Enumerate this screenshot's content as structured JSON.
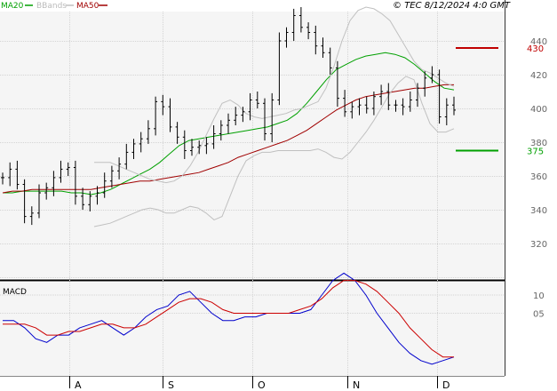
{
  "header": {
    "legend": [
      {
        "label": "MA20",
        "color": "#00a000"
      },
      {
        "label": "BBands",
        "color": "#c0c0c0"
      },
      {
        "label": "MA50",
        "color": "#a00000"
      }
    ],
    "timestamp": "© TEC 8/12/2024 4:0 GMT"
  },
  "macd_panel": {
    "label": "MACD"
  },
  "chart_data": [
    {
      "type": "line",
      "panel": "price",
      "x_ticks": [
        "A",
        "S",
        "O",
        "N",
        "D"
      ],
      "y_ticks": [
        320,
        340,
        360,
        380,
        400,
        420,
        440
      ],
      "ylim": [
        300,
        460
      ],
      "grid": true,
      "legend_placement": "top-left",
      "annotations": [
        {
          "label": "430",
          "value": 430,
          "color": "#c00000"
        },
        {
          "label": "375",
          "value": 375,
          "color": "#00a000"
        }
      ],
      "series": [
        {
          "name": "MA20",
          "color": "#00a000",
          "values": [
            350,
            350,
            351,
            351,
            351,
            351,
            351,
            350,
            350,
            349,
            350,
            352,
            355,
            358,
            361,
            364,
            368,
            373,
            378,
            381,
            382,
            383,
            384,
            385,
            386,
            387,
            388,
            389,
            391,
            393,
            397,
            403,
            410,
            417,
            423,
            426,
            429,
            431,
            432,
            433,
            432,
            430,
            426,
            421,
            416,
            412,
            411
          ]
        },
        {
          "name": "MA50",
          "color": "#a00000",
          "values": [
            350,
            351,
            351,
            352,
            352,
            352,
            352,
            352,
            352,
            352,
            353,
            354,
            355,
            356,
            357,
            357,
            358,
            359,
            360,
            361,
            362,
            364,
            366,
            368,
            371,
            373,
            375,
            377,
            379,
            381,
            384,
            387,
            391,
            395,
            399,
            402,
            405,
            407,
            408,
            409,
            410,
            411,
            412,
            412,
            413,
            414,
            414
          ]
        },
        {
          "name": "BBands",
          "color": "#c0c0c0",
          "values": [
            368,
            368,
            368,
            366,
            364,
            362,
            360,
            358,
            357,
            356,
            357,
            360,
            366,
            374,
            384,
            394,
            403,
            405,
            402,
            397,
            395,
            394,
            395,
            396,
            397,
            399,
            400,
            402,
            404,
            412,
            425,
            440,
            452,
            458,
            460,
            459,
            456,
            452,
            444,
            436,
            428,
            423,
            421,
            418,
            415,
            413
          ]
        },
        {
          "name": "BBands-lower",
          "color": "#c0c0c0",
          "values": [
            330,
            331,
            332,
            334,
            336,
            338,
            340,
            341,
            340,
            338,
            338,
            340,
            342,
            341,
            338,
            334,
            336,
            348,
            360,
            369,
            372,
            374,
            374,
            375,
            375,
            375,
            375,
            375,
            376,
            374,
            371,
            370,
            374,
            380,
            386,
            393,
            401,
            409,
            415,
            419,
            417,
            403,
            391,
            386,
            386,
            388
          ]
        }
      ],
      "ohlc_close": [
        359,
        364,
        355,
        336,
        338,
        350,
        353,
        359,
        364,
        365,
        348,
        343,
        348,
        350,
        357,
        363,
        367,
        374,
        379,
        382,
        388,
        404,
        401,
        389,
        383,
        375,
        377,
        378,
        379,
        385,
        390,
        393,
        396,
        398,
        405,
        403,
        385,
        405,
        440,
        445,
        455,
        448,
        445,
        437,
        433,
        424,
        406,
        398,
        401,
        402,
        400,
        407,
        410,
        402,
        402,
        401,
        405,
        412,
        418,
        420,
        395,
        402,
        399
      ]
    },
    {
      "type": "line",
      "panel": "macd",
      "label": "MACD",
      "y_ticks": [
        "10",
        "05"
      ],
      "series": [
        {
          "name": "MACD",
          "color": "#0000cc",
          "values": [
            3,
            3,
            1,
            -2,
            -3,
            -1,
            -1,
            1,
            2,
            3,
            1,
            -1,
            1,
            4,
            6,
            7,
            10,
            11,
            8,
            5,
            3,
            3,
            4,
            4,
            5,
            5,
            5,
            5,
            6,
            10,
            14,
            16,
            14,
            10,
            5,
            1,
            -3,
            -6,
            -8,
            -9,
            -8,
            -7
          ]
        },
        {
          "name": "Signal",
          "color": "#cc0000",
          "values": [
            2,
            2,
            2,
            1,
            -1,
            -1,
            0,
            0,
            1,
            2,
            2,
            1,
            1,
            2,
            4,
            6,
            8,
            9,
            9,
            8,
            6,
            5,
            5,
            5,
            5,
            5,
            5,
            6,
            7,
            9,
            12,
            14,
            14,
            13,
            11,
            8,
            5,
            1,
            -2,
            -5,
            -7,
            -7
          ]
        }
      ]
    }
  ]
}
